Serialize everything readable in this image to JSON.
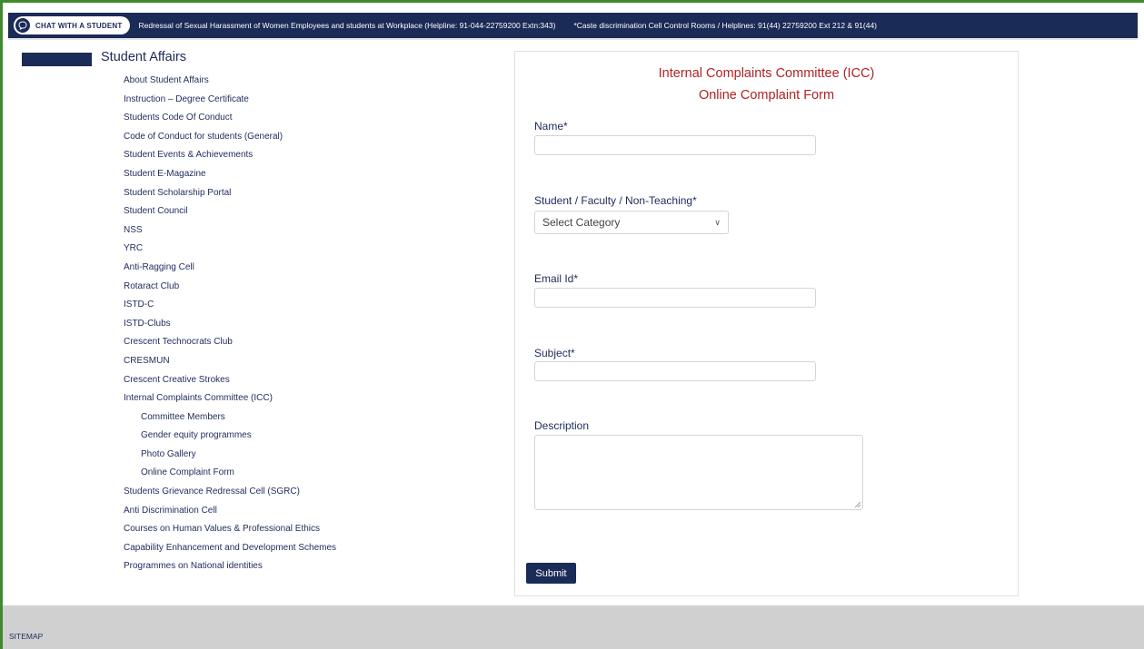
{
  "topbar": {
    "chat_label": "CHAT WITH A STUDENT",
    "ticker_1": "Redressal of Sexual Harassment of Women Employees and students at Workplace (Helpline: 91-044-22759200 Extn:343)",
    "ticker_2": "*Caste discrimination Cell Control Rooms / Helplines: 91(44) 22759200 Ext 212 & 91(44)"
  },
  "sidebar": {
    "heading": "Student Affairs",
    "items": [
      {
        "label": "About Student Affairs"
      },
      {
        "label": "Instruction – Degree Certificate"
      },
      {
        "label": "Students Code Of Conduct"
      },
      {
        "label": "Code of Conduct for students (General)"
      },
      {
        "label": "Student Events & Achievements"
      },
      {
        "label": "Student E-Magazine"
      },
      {
        "label": "Student Scholarship Portal"
      },
      {
        "label": "Student Council"
      },
      {
        "label": "NSS"
      },
      {
        "label": "YRC"
      },
      {
        "label": "Anti-Ragging Cell"
      },
      {
        "label": "Rotaract Club"
      },
      {
        "label": "ISTD-C"
      },
      {
        "label": "ISTD-Clubs"
      },
      {
        "label": "Crescent Technocrats Club"
      },
      {
        "label": "CRESMUN"
      },
      {
        "label": "Crescent Creative Strokes"
      },
      {
        "label": "Internal Complaints Committee (ICC)"
      },
      {
        "label": "Committee Members"
      },
      {
        "label": "Gender equity programmes"
      },
      {
        "label": "Photo Gallery"
      },
      {
        "label": "Online Complaint Form"
      },
      {
        "label": "Students Grievance Redressal Cell (SGRC)"
      },
      {
        "label": "Anti Discrimination Cell"
      },
      {
        "label": "Courses on Human Values & Professional Ethics"
      },
      {
        "label": "Capability Enhancement and Development Schemes"
      },
      {
        "label": "Programmes on National identities"
      }
    ]
  },
  "form": {
    "title_1": "Internal Complaints Committee (ICC)",
    "title_2": "Online Complaint Form",
    "name_label": "Name*",
    "name_value": "",
    "category_label": "Student / Faculty / Non-Teaching*",
    "category_selected": "Select Category",
    "email_label": "Email Id*",
    "email_value": "",
    "subject_label": "Subject*",
    "subject_value": "",
    "description_label": "Description",
    "description_value": "",
    "submit_label": "Submit"
  },
  "footer": {
    "sitemap_label": "SITEMAP"
  },
  "colors": {
    "navy": "#1b2b57",
    "title_red": "#b22222",
    "frame_green": "#3f8a2e",
    "footer_grey": "#d0d0d0"
  },
  "icons": {
    "chat": "chat-bubble-icon",
    "select": "chevron-down-icon",
    "textarea": "resize-handle-icon"
  }
}
